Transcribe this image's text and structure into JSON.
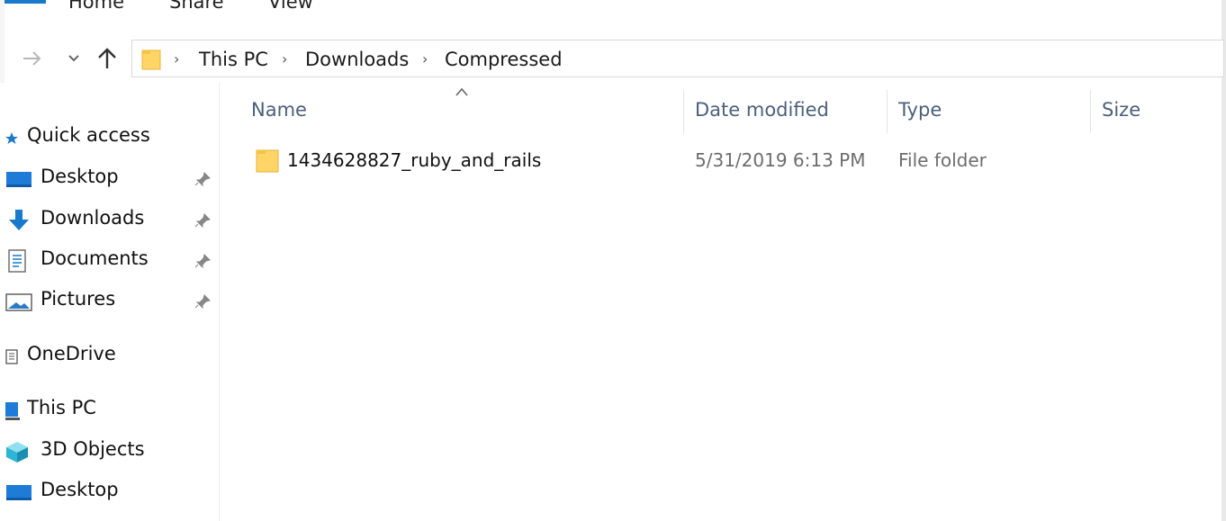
{
  "ribbon": {
    "tabs": [
      "Home",
      "Share",
      "View"
    ]
  },
  "navigation": {
    "breadcrumb": [
      "This PC",
      "Downloads",
      "Compressed"
    ],
    "separator": "›"
  },
  "sidebar": {
    "quick_access": "Quick access",
    "items": [
      {
        "label": "Desktop",
        "icon": "desktop-icon",
        "pinned": true
      },
      {
        "label": "Downloads",
        "icon": "download-arrow-icon",
        "pinned": true
      },
      {
        "label": "Documents",
        "icon": "document-icon",
        "pinned": true
      },
      {
        "label": "Pictures",
        "icon": "pictures-icon",
        "pinned": true
      }
    ],
    "onedrive": "OneDrive",
    "this_pc": "This PC",
    "this_pc_items": [
      {
        "label": "3D Objects",
        "icon": "cube-3d-icon"
      },
      {
        "label": "Desktop",
        "icon": "desktop-icon"
      }
    ]
  },
  "file_list": {
    "columns": [
      "Name",
      "Date modified",
      "Type",
      "Size"
    ],
    "rows": [
      {
        "name": "1434628827_ruby_and_rails",
        "date_modified": "5/31/2019 6:13 PM",
        "type": "File folder",
        "size": ""
      }
    ]
  },
  "colors": {
    "accent": "#1979ca",
    "folder_yellow": "#ffd666",
    "header_text": "#4c607a",
    "row_meta_text": "#6d6d6d"
  }
}
